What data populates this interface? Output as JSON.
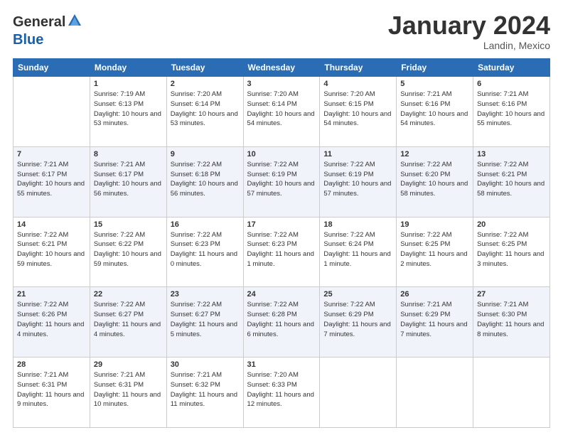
{
  "header": {
    "logo_general": "General",
    "logo_blue": "Blue",
    "month_title": "January 2024",
    "location": "Landin, Mexico"
  },
  "days_of_week": [
    "Sunday",
    "Monday",
    "Tuesday",
    "Wednesday",
    "Thursday",
    "Friday",
    "Saturday"
  ],
  "weeks": [
    [
      {
        "day": "",
        "sunrise": "",
        "sunset": "",
        "daylight": "",
        "empty": true
      },
      {
        "day": "1",
        "sunrise": "Sunrise: 7:19 AM",
        "sunset": "Sunset: 6:13 PM",
        "daylight": "Daylight: 10 hours and 53 minutes."
      },
      {
        "day": "2",
        "sunrise": "Sunrise: 7:20 AM",
        "sunset": "Sunset: 6:14 PM",
        "daylight": "Daylight: 10 hours and 53 minutes."
      },
      {
        "day": "3",
        "sunrise": "Sunrise: 7:20 AM",
        "sunset": "Sunset: 6:14 PM",
        "daylight": "Daylight: 10 hours and 54 minutes."
      },
      {
        "day": "4",
        "sunrise": "Sunrise: 7:20 AM",
        "sunset": "Sunset: 6:15 PM",
        "daylight": "Daylight: 10 hours and 54 minutes."
      },
      {
        "day": "5",
        "sunrise": "Sunrise: 7:21 AM",
        "sunset": "Sunset: 6:16 PM",
        "daylight": "Daylight: 10 hours and 54 minutes."
      },
      {
        "day": "6",
        "sunrise": "Sunrise: 7:21 AM",
        "sunset": "Sunset: 6:16 PM",
        "daylight": "Daylight: 10 hours and 55 minutes."
      }
    ],
    [
      {
        "day": "7",
        "sunrise": "Sunrise: 7:21 AM",
        "sunset": "Sunset: 6:17 PM",
        "daylight": "Daylight: 10 hours and 55 minutes."
      },
      {
        "day": "8",
        "sunrise": "Sunrise: 7:21 AM",
        "sunset": "Sunset: 6:17 PM",
        "daylight": "Daylight: 10 hours and 56 minutes."
      },
      {
        "day": "9",
        "sunrise": "Sunrise: 7:22 AM",
        "sunset": "Sunset: 6:18 PM",
        "daylight": "Daylight: 10 hours and 56 minutes."
      },
      {
        "day": "10",
        "sunrise": "Sunrise: 7:22 AM",
        "sunset": "Sunset: 6:19 PM",
        "daylight": "Daylight: 10 hours and 57 minutes."
      },
      {
        "day": "11",
        "sunrise": "Sunrise: 7:22 AM",
        "sunset": "Sunset: 6:19 PM",
        "daylight": "Daylight: 10 hours and 57 minutes."
      },
      {
        "day": "12",
        "sunrise": "Sunrise: 7:22 AM",
        "sunset": "Sunset: 6:20 PM",
        "daylight": "Daylight: 10 hours and 58 minutes."
      },
      {
        "day": "13",
        "sunrise": "Sunrise: 7:22 AM",
        "sunset": "Sunset: 6:21 PM",
        "daylight": "Daylight: 10 hours and 58 minutes."
      }
    ],
    [
      {
        "day": "14",
        "sunrise": "Sunrise: 7:22 AM",
        "sunset": "Sunset: 6:21 PM",
        "daylight": "Daylight: 10 hours and 59 minutes."
      },
      {
        "day": "15",
        "sunrise": "Sunrise: 7:22 AM",
        "sunset": "Sunset: 6:22 PM",
        "daylight": "Daylight: 10 hours and 59 minutes."
      },
      {
        "day": "16",
        "sunrise": "Sunrise: 7:22 AM",
        "sunset": "Sunset: 6:23 PM",
        "daylight": "Daylight: 11 hours and 0 minutes."
      },
      {
        "day": "17",
        "sunrise": "Sunrise: 7:22 AM",
        "sunset": "Sunset: 6:23 PM",
        "daylight": "Daylight: 11 hours and 1 minute."
      },
      {
        "day": "18",
        "sunrise": "Sunrise: 7:22 AM",
        "sunset": "Sunset: 6:24 PM",
        "daylight": "Daylight: 11 hours and 1 minute."
      },
      {
        "day": "19",
        "sunrise": "Sunrise: 7:22 AM",
        "sunset": "Sunset: 6:25 PM",
        "daylight": "Daylight: 11 hours and 2 minutes."
      },
      {
        "day": "20",
        "sunrise": "Sunrise: 7:22 AM",
        "sunset": "Sunset: 6:25 PM",
        "daylight": "Daylight: 11 hours and 3 minutes."
      }
    ],
    [
      {
        "day": "21",
        "sunrise": "Sunrise: 7:22 AM",
        "sunset": "Sunset: 6:26 PM",
        "daylight": "Daylight: 11 hours and 4 minutes."
      },
      {
        "day": "22",
        "sunrise": "Sunrise: 7:22 AM",
        "sunset": "Sunset: 6:27 PM",
        "daylight": "Daylight: 11 hours and 4 minutes."
      },
      {
        "day": "23",
        "sunrise": "Sunrise: 7:22 AM",
        "sunset": "Sunset: 6:27 PM",
        "daylight": "Daylight: 11 hours and 5 minutes."
      },
      {
        "day": "24",
        "sunrise": "Sunrise: 7:22 AM",
        "sunset": "Sunset: 6:28 PM",
        "daylight": "Daylight: 11 hours and 6 minutes."
      },
      {
        "day": "25",
        "sunrise": "Sunrise: 7:22 AM",
        "sunset": "Sunset: 6:29 PM",
        "daylight": "Daylight: 11 hours and 7 minutes."
      },
      {
        "day": "26",
        "sunrise": "Sunrise: 7:21 AM",
        "sunset": "Sunset: 6:29 PM",
        "daylight": "Daylight: 11 hours and 7 minutes."
      },
      {
        "day": "27",
        "sunrise": "Sunrise: 7:21 AM",
        "sunset": "Sunset: 6:30 PM",
        "daylight": "Daylight: 11 hours and 8 minutes."
      }
    ],
    [
      {
        "day": "28",
        "sunrise": "Sunrise: 7:21 AM",
        "sunset": "Sunset: 6:31 PM",
        "daylight": "Daylight: 11 hours and 9 minutes."
      },
      {
        "day": "29",
        "sunrise": "Sunrise: 7:21 AM",
        "sunset": "Sunset: 6:31 PM",
        "daylight": "Daylight: 11 hours and 10 minutes."
      },
      {
        "day": "30",
        "sunrise": "Sunrise: 7:21 AM",
        "sunset": "Sunset: 6:32 PM",
        "daylight": "Daylight: 11 hours and 11 minutes."
      },
      {
        "day": "31",
        "sunrise": "Sunrise: 7:20 AM",
        "sunset": "Sunset: 6:33 PM",
        "daylight": "Daylight: 11 hours and 12 minutes."
      },
      {
        "day": "",
        "empty": true
      },
      {
        "day": "",
        "empty": true
      },
      {
        "day": "",
        "empty": true
      }
    ]
  ]
}
